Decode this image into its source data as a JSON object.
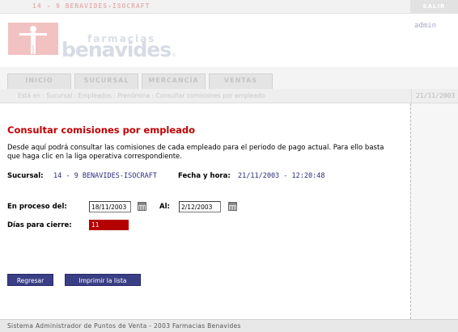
{
  "topbar": {
    "store": "14 - 9   BENAVIDES-ISOCRAFT",
    "logout_label": "SALIR"
  },
  "header": {
    "logo_top": "farmacias",
    "logo_main": "benavides",
    "logo_tm": "®",
    "user": "admin"
  },
  "tabs": [
    {
      "label": "INICIO"
    },
    {
      "label": "SUCURSAL"
    },
    {
      "label": "MERCANCÍA"
    },
    {
      "label": "VENTAS"
    }
  ],
  "breadcrumb": {
    "text": "Está en : Sucursal : Empleados : Prenómina : Consultar comisiones por empleado",
    "date": "21/11/2003"
  },
  "main": {
    "title": "Consultar comisiones por empleado",
    "description": "Desde aquí podrá consultar las comisiones de cada empleado para el periodo de pago actual. Para ello basta que haga clic en la liga operativa correspondiente.",
    "sucursal_label": "Sucursal:",
    "sucursal_value": "14 - 9   BENAVIDES-ISOCRAFT",
    "fecha_label": "Fecha y hora:",
    "fecha_value": "21/11/2003 - 12:20:48",
    "proceso_label": "En proceso del:",
    "proceso_from": "18/11/2003",
    "al_label": "Al:",
    "proceso_to": "2/12/2003",
    "dias_label": "Días para cierre:",
    "dias_value": "11",
    "back_label": "Regresar",
    "print_label": "Imprimir la lista"
  },
  "footer": {
    "text": "Sistema Administrador de Puntos de Venta - 2003 Farmacias Benavides"
  },
  "colors": {
    "accent": "#c00000",
    "button": "#3a3f85",
    "days_badge": "#b50000"
  },
  "icons": [
    "calendar-icon",
    "calendar-icon",
    "logo-figure-icon"
  ]
}
